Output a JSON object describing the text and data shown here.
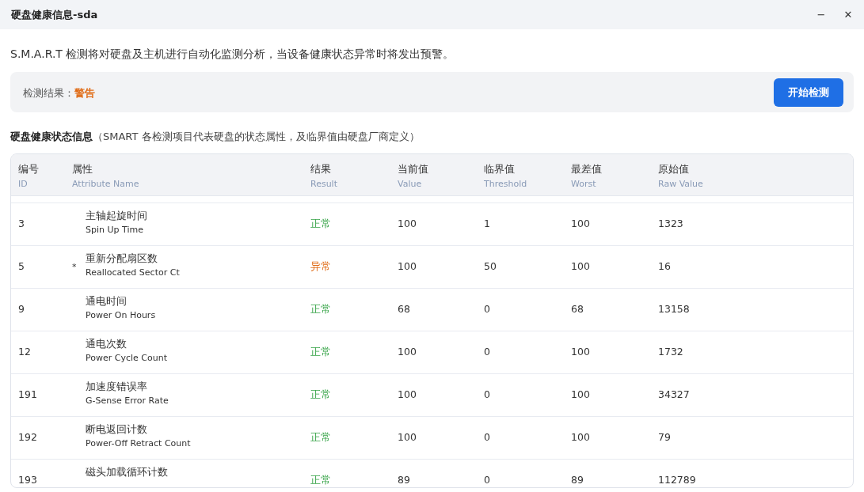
{
  "window": {
    "title": "硬盘健康信息-sda",
    "minimize": "−",
    "close": "✕"
  },
  "description": "S.M.A.R.T 检测将对硬盘及主机进行自动化监测分析，当设备健康状态异常时将发出预警。",
  "check": {
    "label": "检测结果：",
    "result": "警告",
    "color": "#e06c17",
    "button": "开始检测"
  },
  "section": {
    "title": "硬盘健康状态信息",
    "note": "（SMART 各检测项目代表硬盘的状态属性，及临界值由硬盘厂商定义）"
  },
  "table": {
    "columns": [
      {
        "label": "编号",
        "sub": "ID"
      },
      {
        "label": "属性",
        "sub": "Attribute Name"
      },
      {
        "label": "结果",
        "sub": "Result"
      },
      {
        "label": "当前值",
        "sub": "Value"
      },
      {
        "label": "临界值",
        "sub": "Threshold"
      },
      {
        "label": "最差值",
        "sub": "Worst"
      },
      {
        "label": "原始值",
        "sub": "Raw Value"
      }
    ],
    "rows": [
      {
        "id": "3",
        "name": "主轴起旋时间",
        "name_en": "Spin Up Time",
        "result": "正常",
        "color": "#3aa54a",
        "value": "100",
        "threshold": "1",
        "worst": "100",
        "raw": "1323"
      },
      {
        "id": "5",
        "flag": "*",
        "name": "重新分配扇区数",
        "name_en": "Reallocated Sector Ct",
        "result": "异常",
        "color": "#e06c17",
        "value": "100",
        "threshold": "50",
        "worst": "100",
        "raw": "16"
      },
      {
        "id": "9",
        "name": "通电时间",
        "name_en": "Power On Hours",
        "result": "正常",
        "color": "#3aa54a",
        "value": "68",
        "threshold": "0",
        "worst": "68",
        "raw": "13158"
      },
      {
        "id": "12",
        "name": "通电次数",
        "name_en": "Power Cycle Count",
        "result": "正常",
        "color": "#3aa54a",
        "value": "100",
        "threshold": "0",
        "worst": "100",
        "raw": "1732"
      },
      {
        "id": "191",
        "name": "加速度错误率",
        "name_en": "G-Sense Error Rate",
        "result": "正常",
        "color": "#3aa54a",
        "value": "100",
        "threshold": "0",
        "worst": "100",
        "raw": "34327"
      },
      {
        "id": "192",
        "name": "断电返回计数",
        "name_en": "Power-Off Retract Count",
        "result": "正常",
        "color": "#3aa54a",
        "value": "100",
        "threshold": "0",
        "worst": "100",
        "raw": "79"
      },
      {
        "id": "193",
        "name": "磁头加载循环计数",
        "result": "正常",
        "color": "#3aa54a",
        "value": "89",
        "threshold": "0",
        "worst": "89",
        "raw": "112789"
      }
    ]
  }
}
